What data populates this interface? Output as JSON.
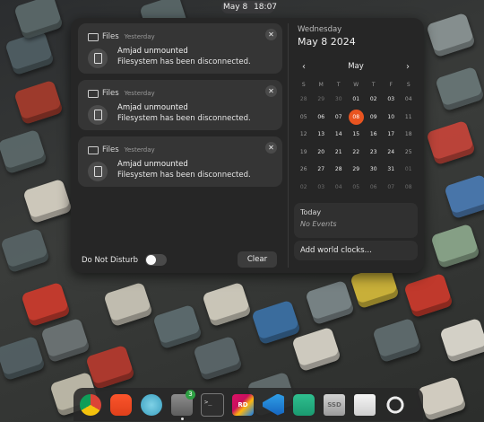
{
  "topbar": {
    "date": "May 8",
    "time": "18:07"
  },
  "notifications": [
    {
      "app": "Files",
      "time": "Yesterday",
      "title": "Amjad unmounted",
      "body": "Filesystem has been disconnected."
    },
    {
      "app": "Files",
      "time": "Yesterday",
      "title": "Amjad unmounted",
      "body": "Filesystem has been disconnected."
    },
    {
      "app": "Files",
      "time": "Yesterday",
      "title": "Amjad unmounted",
      "body": "Filesystem has been disconnected."
    }
  ],
  "tray_footer": {
    "dnd_label": "Do Not Disturb",
    "dnd_on": false,
    "clear_label": "Clear"
  },
  "calendar": {
    "weekday": "Wednesday",
    "date": "May 8 2024",
    "month": "May",
    "weekdays_short": [
      "S",
      "M",
      "T",
      "W",
      "T",
      "F",
      "S"
    ],
    "weeks": [
      [
        "28",
        "29",
        "30",
        "01",
        "02",
        "03",
        "04"
      ],
      [
        "05",
        "06",
        "07",
        "08",
        "09",
        "10",
        "11"
      ],
      [
        "12",
        "13",
        "14",
        "15",
        "16",
        "17",
        "18"
      ],
      [
        "19",
        "20",
        "21",
        "22",
        "23",
        "24",
        "25"
      ],
      [
        "26",
        "27",
        "28",
        "29",
        "30",
        "31",
        "01"
      ],
      [
        "02",
        "03",
        "04",
        "05",
        "06",
        "07",
        "08"
      ]
    ],
    "today": "08",
    "events": {
      "heading": "Today",
      "empty": "No Events"
    },
    "world_clocks": "Add world clocks…"
  },
  "dock": {
    "items": [
      {
        "icon": "chrome-icon",
        "running": false
      },
      {
        "icon": "brave-icon",
        "running": false
      },
      {
        "icon": "mail-icon",
        "running": false
      },
      {
        "icon": "files-icon",
        "running": true,
        "badge": "3"
      },
      {
        "icon": "terminal-icon",
        "running": false
      },
      {
        "icon": "rider-icon",
        "running": false,
        "label": "RD"
      },
      {
        "icon": "vscode-icon",
        "running": false
      },
      {
        "icon": "text-editor-icon",
        "running": false
      },
      {
        "icon": "ssd-icon",
        "running": false,
        "label": "SSD"
      },
      {
        "icon": "trash-icon",
        "running": false
      },
      {
        "icon": "ubuntu-apps-icon",
        "running": false
      }
    ]
  },
  "colors": {
    "accent": "#e95420",
    "tray_bg": "#262626",
    "card_bg": "#353535"
  }
}
